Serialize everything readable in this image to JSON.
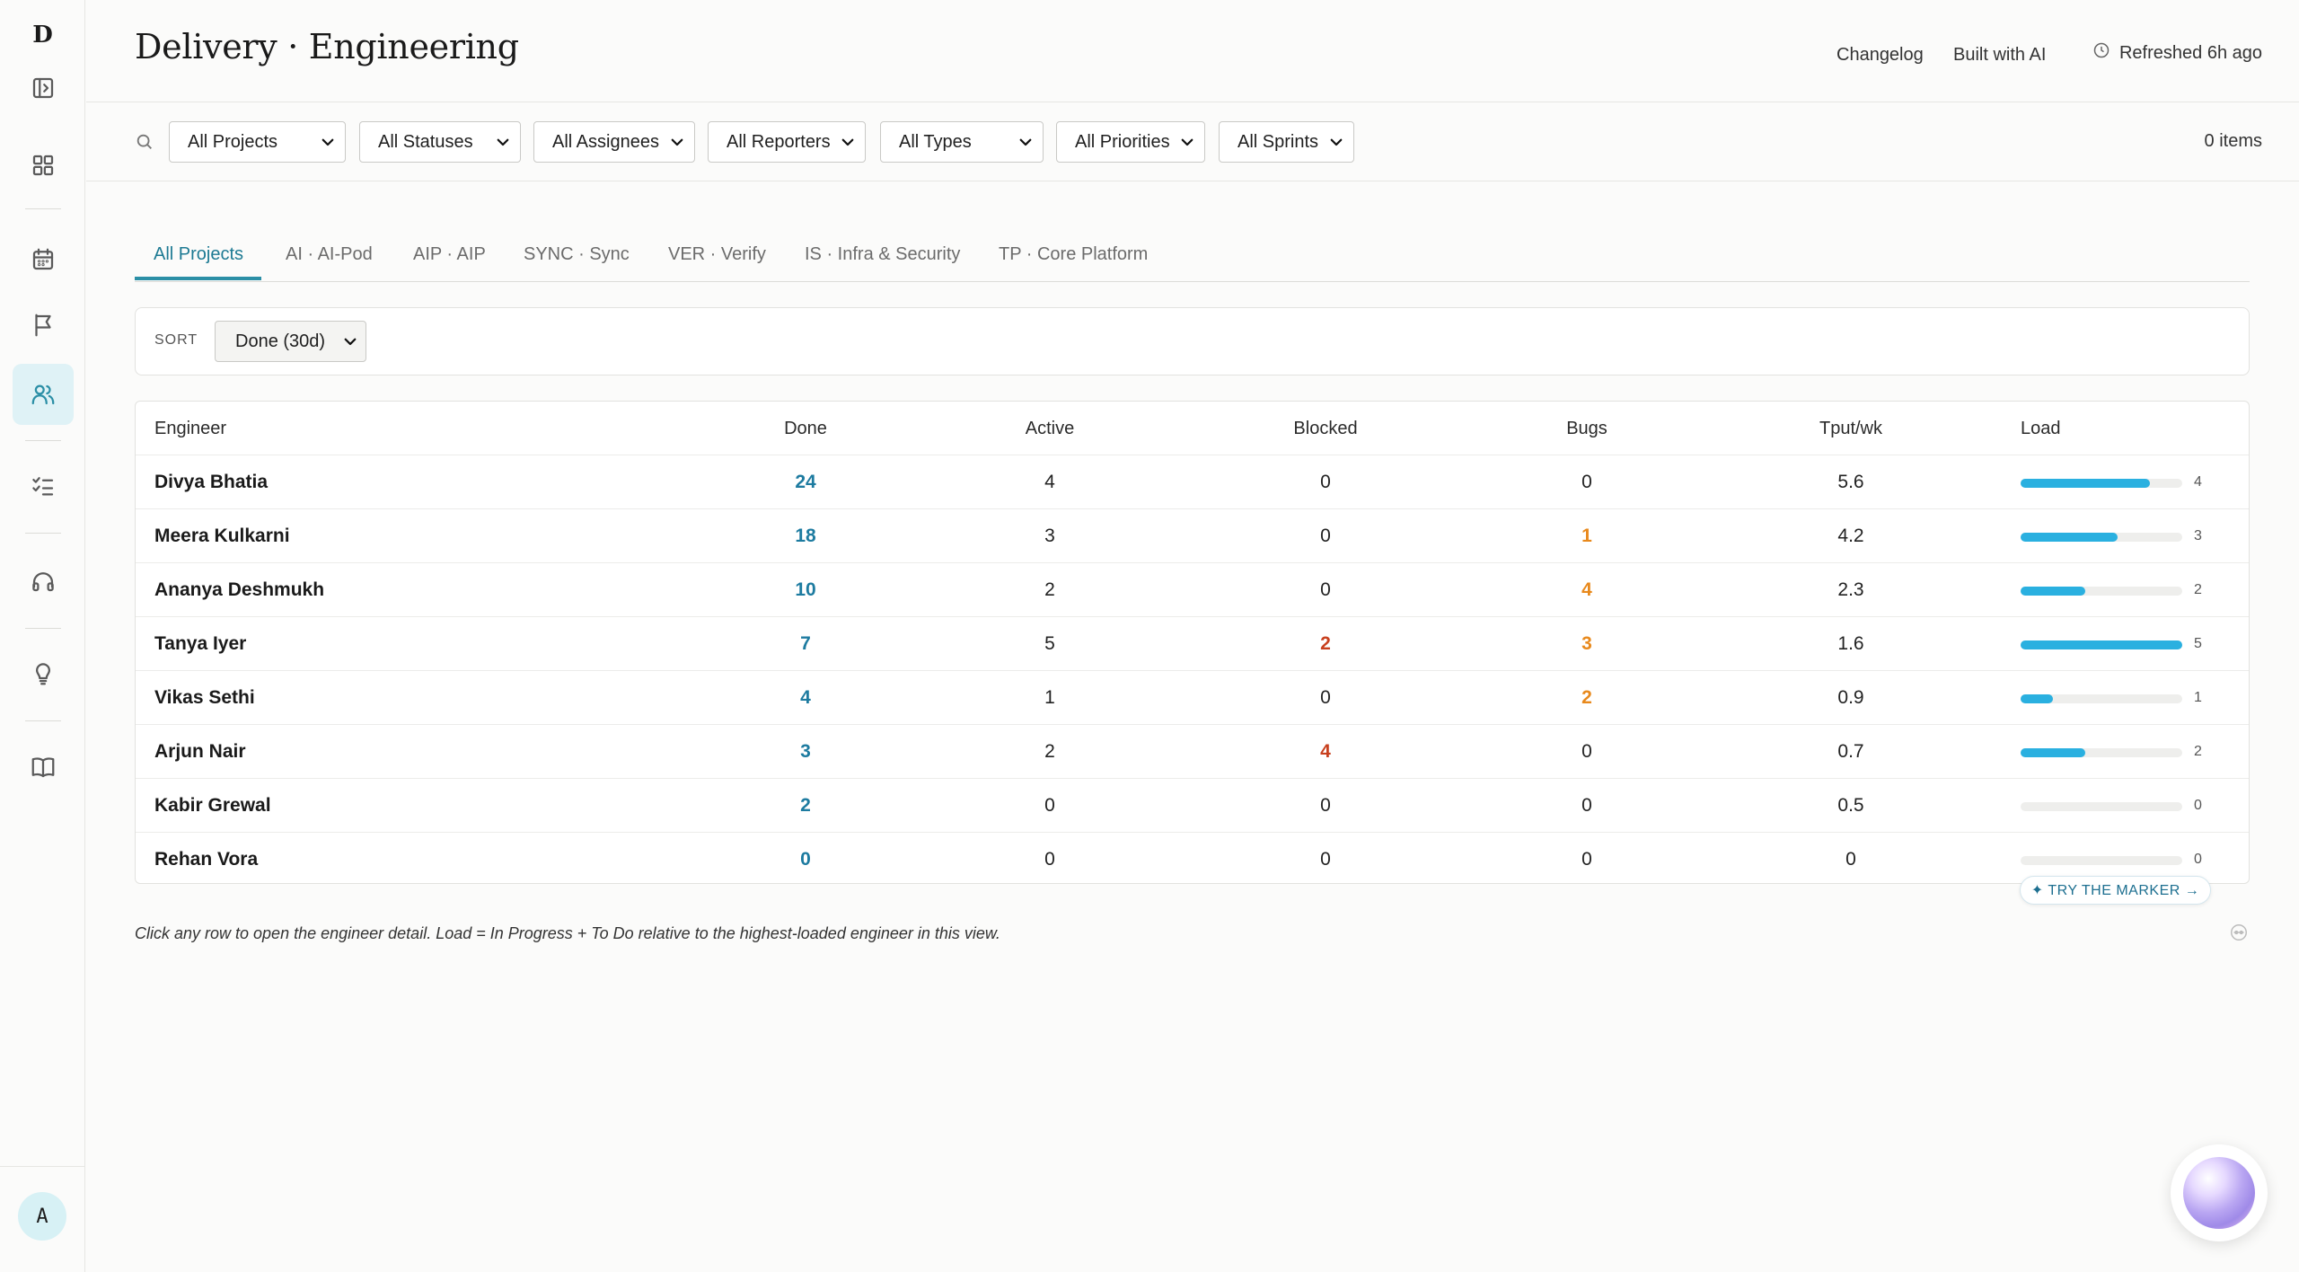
{
  "sidebar": {
    "logo": "D",
    "avatar": "A",
    "icons": [
      "panel-toggle-icon",
      "grid-icon",
      "calendar-icon",
      "flag-icon",
      "users-icon",
      "checklist-icon",
      "headphones-icon",
      "lightbulb-icon",
      "book-icon"
    ],
    "active": "users-icon"
  },
  "header": {
    "title": "Delivery · Engineering",
    "links": [
      "Changelog",
      "Built with AI"
    ],
    "refreshed": "Refreshed 6h ago"
  },
  "filters": {
    "selects": [
      "All Projects",
      "All Statuses",
      "All Assignees",
      "All Reporters",
      "All Types",
      "All Priorities",
      "All Sprints"
    ],
    "count": "0 items"
  },
  "tabs": [
    "All Projects",
    "AI · AI-Pod",
    "AIP · AIP",
    "SYNC · Sync",
    "VER · Verify",
    "IS · Infra & Security",
    "TP · Core Platform"
  ],
  "sort": {
    "label": "SORT",
    "value": "Done (30d)"
  },
  "table": {
    "columns": [
      "Engineer",
      "Done",
      "Active",
      "Blocked",
      "Bugs",
      "Tput/wk",
      "Load"
    ],
    "rows": [
      {
        "name": "Divya Bhatia",
        "done": "24",
        "active": "4",
        "blocked": "0",
        "bugs": "0",
        "tput": "5.6",
        "load": "4",
        "load_fraction": 0.8
      },
      {
        "name": "Meera Kulkarni",
        "done": "18",
        "active": "3",
        "blocked": "0",
        "bugs": "1",
        "tput": "4.2",
        "load": "3",
        "load_fraction": 0.6
      },
      {
        "name": "Ananya Deshmukh",
        "done": "10",
        "active": "2",
        "blocked": "0",
        "bugs": "4",
        "tput": "2.3",
        "load": "2",
        "load_fraction": 0.4
      },
      {
        "name": "Tanya Iyer",
        "done": "7",
        "active": "5",
        "blocked": "2",
        "bugs": "3",
        "tput": "1.6",
        "load": "5",
        "load_fraction": 1.0
      },
      {
        "name": "Vikas Sethi",
        "done": "4",
        "active": "1",
        "blocked": "0",
        "bugs": "2",
        "tput": "0.9",
        "load": "1",
        "load_fraction": 0.2
      },
      {
        "name": "Arjun Nair",
        "done": "3",
        "active": "2",
        "blocked": "4",
        "bugs": "0",
        "tput": "0.7",
        "load": "2",
        "load_fraction": 0.4
      },
      {
        "name": "Kabir Grewal",
        "done": "2",
        "active": "0",
        "blocked": "0",
        "bugs": "0",
        "tput": "0.5",
        "load": "0",
        "load_fraction": 0.0
      },
      {
        "name": "Rehan Vora",
        "done": "0",
        "active": "0",
        "blocked": "0",
        "bugs": "0",
        "tput": "0",
        "load": "0",
        "load_fraction": 0.0
      }
    ]
  },
  "marker_button": "✦ TRY THE MARKER →",
  "footnote": "Click any row to open the engineer detail. Load = In Progress + To Do relative to the highest-loaded engineer in this view.",
  "colors": {
    "accent": "#2b8fa6",
    "done": "#1d7ba0",
    "blocked": "#c8401e",
    "bugs": "#e8891c",
    "load_bar": "#2ab0e0"
  }
}
